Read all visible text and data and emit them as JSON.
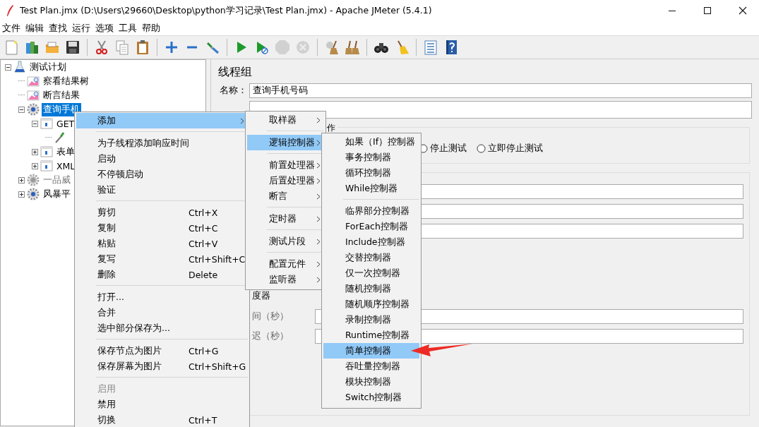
{
  "window": {
    "title": "Test Plan.jmx (D:\\Users\\29660\\Desktop\\python学习记录\\Test Plan.jmx) - Apache JMeter (5.4.1)"
  },
  "menu_bar": [
    "文件",
    "编辑",
    "查找",
    "运行",
    "选项",
    "工具",
    "帮助"
  ],
  "toolbar": [
    {
      "kind": "new",
      "disabled": false
    },
    {
      "kind": "templates",
      "disabled": false
    },
    {
      "kind": "open",
      "disabled": false
    },
    {
      "kind": "save",
      "disabled": false
    },
    {
      "kind": "separator"
    },
    {
      "kind": "cut",
      "disabled": false
    },
    {
      "kind": "copy",
      "disabled": false
    },
    {
      "kind": "paste",
      "disabled": false
    },
    {
      "kind": "separator"
    },
    {
      "kind": "expand",
      "disabled": false
    },
    {
      "kind": "collapse",
      "disabled": false
    },
    {
      "kind": "toggle",
      "disabled": false
    },
    {
      "kind": "separator"
    },
    {
      "kind": "start",
      "disabled": false
    },
    {
      "kind": "start_no_pauses",
      "disabled": false
    },
    {
      "kind": "stop",
      "disabled": true
    },
    {
      "kind": "shutdown",
      "disabled": true
    },
    {
      "kind": "separator"
    },
    {
      "kind": "clear",
      "disabled": false
    },
    {
      "kind": "clear_all",
      "disabled": false
    },
    {
      "kind": "separator"
    },
    {
      "kind": "search",
      "disabled": false
    },
    {
      "kind": "reset_search",
      "disabled": false
    },
    {
      "kind": "separator"
    },
    {
      "kind": "functions",
      "disabled": false
    },
    {
      "kind": "help",
      "disabled": false
    }
  ],
  "tree": [
    {
      "label": "测试计划",
      "kind": "plan",
      "expanded": true,
      "selected": false,
      "disabled": false,
      "children": [
        {
          "label": "察看结果树",
          "kind": "listener",
          "selected": false,
          "disabled": false
        },
        {
          "label": "断言结果",
          "kind": "listener",
          "selected": false,
          "disabled": false
        },
        {
          "label": "查询手机",
          "kind": "thread_group",
          "expanded": true,
          "selected": true,
          "disabled": false,
          "children": [
            {
              "label": "GET",
              "kind": "sampler",
              "expanded": true,
              "selected": false,
              "disabled": false,
              "children": [
                {
                  "kind": "extractor",
                  "selected": false,
                  "disabled": false
                }
              ]
            },
            {
              "label": "表单",
              "kind": "sampler",
              "expanded": false,
              "selected": false,
              "disabled": false
            },
            {
              "label": "XML",
              "kind": "sampler",
              "expanded": false,
              "selected": false,
              "disabled": false
            }
          ]
        },
        {
          "label": "一品威",
          "kind": "thread_group",
          "expanded": false,
          "selected": false,
          "disabled": true
        },
        {
          "label": "风暴平",
          "kind": "thread_group",
          "expanded": false,
          "selected": false,
          "disabled": false
        }
      ]
    }
  ],
  "panel": {
    "title": "线程组",
    "name_label": "名称：",
    "name_value": "查询手机号码",
    "error_action": {
      "title": "作",
      "options": [
        {
          "label": "停止测试",
          "selected": false
        },
        {
          "label": "立即停止测试",
          "selected": false
        }
      ]
    },
    "scheduler_label": "度器",
    "duration_label": "间（秒）",
    "delay_label": "迟（秒）"
  },
  "context_menus": [
    {
      "items": [
        {
          "kind": "item",
          "label": "添加",
          "submenu": true,
          "selected": true,
          "disabled": false
        },
        {
          "kind": "separator"
        },
        {
          "kind": "item",
          "label": "为子线程添加响应时间",
          "selected": false,
          "disabled": false
        },
        {
          "kind": "item",
          "label": "启动",
          "selected": false,
          "disabled": false
        },
        {
          "kind": "item",
          "label": "不停顿启动",
          "selected": false,
          "disabled": false
        },
        {
          "kind": "item",
          "label": "验证",
          "selected": false,
          "disabled": false
        },
        {
          "kind": "separator"
        },
        {
          "kind": "item",
          "label": "剪切",
          "shortcut": "Ctrl+X",
          "selected": false,
          "disabled": false
        },
        {
          "kind": "item",
          "label": "复制",
          "shortcut": "Ctrl+C",
          "selected": false,
          "disabled": false
        },
        {
          "kind": "item",
          "label": "粘贴",
          "shortcut": "Ctrl+V",
          "selected": false,
          "disabled": false
        },
        {
          "kind": "item",
          "label": "复写",
          "shortcut": "Ctrl+Shift+C",
          "selected": false,
          "disabled": false
        },
        {
          "kind": "item",
          "label": "删除",
          "shortcut": "Delete",
          "selected": false,
          "disabled": false
        },
        {
          "kind": "separator"
        },
        {
          "kind": "item",
          "label": "打开...",
          "selected": false,
          "disabled": false
        },
        {
          "kind": "item",
          "label": "合并",
          "selected": false,
          "disabled": false
        },
        {
          "kind": "item",
          "label": "选中部分保存为...",
          "selected": false,
          "disabled": false
        },
        {
          "kind": "separator"
        },
        {
          "kind": "item",
          "label": "保存节点为图片",
          "shortcut": "Ctrl+G",
          "selected": false,
          "disabled": false
        },
        {
          "kind": "item",
          "label": "保存屏幕为图片",
          "shortcut": "Ctrl+Shift+G",
          "selected": false,
          "disabled": false
        },
        {
          "kind": "separator"
        },
        {
          "kind": "item",
          "label": "启用",
          "selected": false,
          "disabled": true
        },
        {
          "kind": "item",
          "label": "禁用",
          "selected": false,
          "disabled": false
        },
        {
          "kind": "item",
          "label": "切换",
          "shortcut": "Ctrl+T",
          "selected": false,
          "disabled": false
        }
      ]
    },
    {
      "items": [
        {
          "kind": "item",
          "label": "取样器",
          "submenu": true,
          "selected": false,
          "disabled": false
        },
        {
          "kind": "separator"
        },
        {
          "kind": "item",
          "label": "逻辑控制器",
          "submenu": true,
          "selected": true,
          "disabled": false
        },
        {
          "kind": "separator"
        },
        {
          "kind": "item",
          "label": "前置处理器",
          "submenu": true,
          "selected": false,
          "disabled": false
        },
        {
          "kind": "item",
          "label": "后置处理器",
          "submenu": true,
          "selected": false,
          "disabled": false
        },
        {
          "kind": "item",
          "label": "断言",
          "submenu": true,
          "selected": false,
          "disabled": false
        },
        {
          "kind": "separator"
        },
        {
          "kind": "item",
          "label": "定时器",
          "submenu": true,
          "selected": false,
          "disabled": false
        },
        {
          "kind": "separator"
        },
        {
          "kind": "item",
          "label": "测试片段",
          "submenu": true,
          "selected": false,
          "disabled": false
        },
        {
          "kind": "separator"
        },
        {
          "kind": "item",
          "label": "配置元件",
          "submenu": true,
          "selected": false,
          "disabled": false
        },
        {
          "kind": "item",
          "label": "监听器",
          "submenu": true,
          "selected": false,
          "disabled": false
        }
      ]
    },
    {
      "items": [
        {
          "kind": "item",
          "label": "如果（If）控制器",
          "selected": false,
          "disabled": false
        },
        {
          "kind": "item",
          "label": "事务控制器",
          "selected": false,
          "disabled": false
        },
        {
          "kind": "item",
          "label": "循环控制器",
          "selected": false,
          "disabled": false
        },
        {
          "kind": "item",
          "label": "While控制器",
          "selected": false,
          "disabled": false
        },
        {
          "kind": "separator"
        },
        {
          "kind": "item",
          "label": "临界部分控制器",
          "selected": false,
          "disabled": false
        },
        {
          "kind": "item",
          "label": "ForEach控制器",
          "selected": false,
          "disabled": false
        },
        {
          "kind": "item",
          "label": "Include控制器",
          "selected": false,
          "disabled": false
        },
        {
          "kind": "item",
          "label": "交替控制器",
          "selected": false,
          "disabled": false
        },
        {
          "kind": "item",
          "label": "仅一次控制器",
          "selected": false,
          "disabled": false
        },
        {
          "kind": "item",
          "label": "随机控制器",
          "selected": false,
          "disabled": false
        },
        {
          "kind": "item",
          "label": "随机顺序控制器",
          "selected": false,
          "disabled": false
        },
        {
          "kind": "item",
          "label": "录制控制器",
          "selected": false,
          "disabled": false
        },
        {
          "kind": "item",
          "label": "Runtime控制器",
          "selected": false,
          "disabled": false
        },
        {
          "kind": "item",
          "label": "简单控制器",
          "selected": true,
          "disabled": false
        },
        {
          "kind": "item",
          "label": "吞吐量控制器",
          "selected": false,
          "disabled": false
        },
        {
          "kind": "item",
          "label": "模块控制器",
          "selected": false,
          "disabled": false
        },
        {
          "kind": "item",
          "label": "Switch控制器",
          "selected": false,
          "disabled": false
        }
      ]
    }
  ]
}
